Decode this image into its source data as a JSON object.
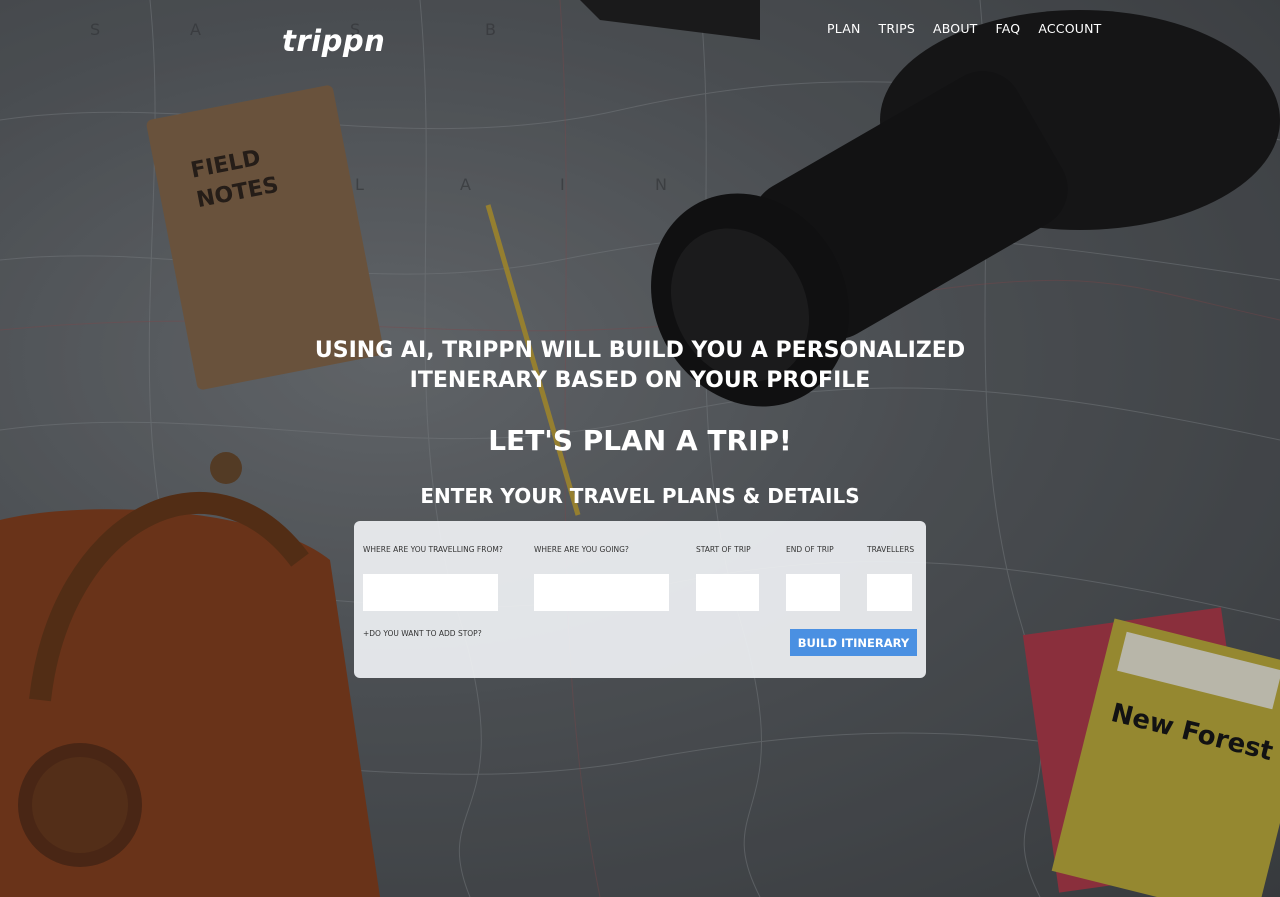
{
  "header": {
    "logo": "trippn",
    "nav": [
      {
        "label": "PLAN"
      },
      {
        "label": "TRIPS"
      },
      {
        "label": "ABOUT"
      },
      {
        "label": "FAQ"
      },
      {
        "label": "ACCOUNT"
      }
    ]
  },
  "hero": {
    "headline_line1": "USING AI, TRIPPN WILL BUILD YOU A PERSONALIZED",
    "headline_line2": "ITENERARY BASED ON YOUR PROFILE",
    "cta_title": "LET'S PLAN A TRIP!",
    "form_heading": "ENTER YOUR TRAVEL PLANS & DETAILS"
  },
  "form": {
    "fields": [
      {
        "label": "WHERE ARE YOU TRAVELLING FROM?",
        "value": ""
      },
      {
        "label": "WHERE ARE YOU GOING?",
        "value": ""
      },
      {
        "label": "START OF TRIP",
        "value": ""
      },
      {
        "label": "END OF TRIP",
        "value": ""
      },
      {
        "label": "TRAVELLERS",
        "value": ""
      }
    ],
    "add_stop": "+DO YOU WANT TO ADD STOP?",
    "submit_label": "BUILD ITINERARY"
  },
  "colors": {
    "accent": "#4a90e2",
    "panel": "#eef0f3",
    "text_light": "#ffffff"
  }
}
